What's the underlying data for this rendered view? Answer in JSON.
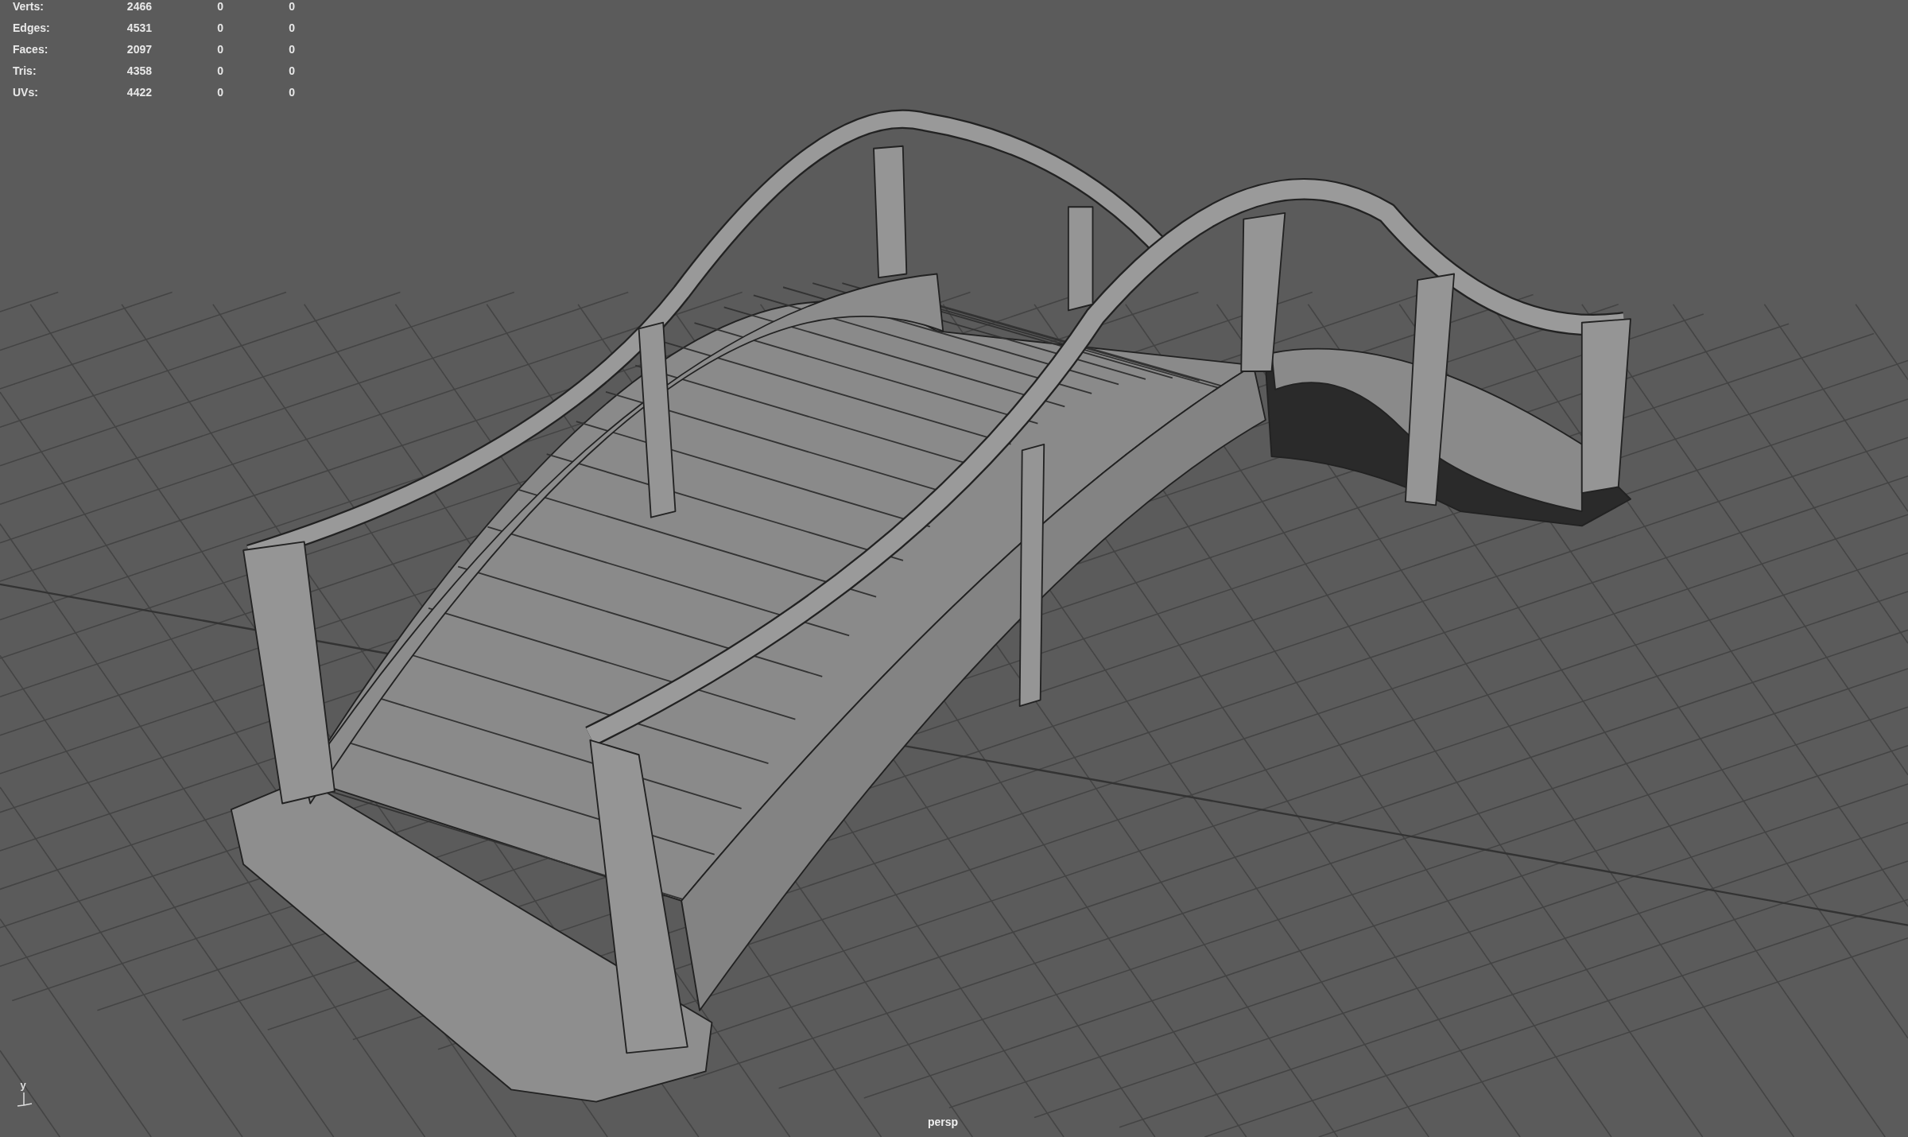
{
  "hud": {
    "stats": [
      {
        "label": "Verts:",
        "values": [
          "2466",
          "0",
          "0"
        ]
      },
      {
        "label": "Edges:",
        "values": [
          "4531",
          "0",
          "0"
        ]
      },
      {
        "label": "Faces:",
        "values": [
          "2097",
          "0",
          "0"
        ]
      },
      {
        "label": "Tris:",
        "values": [
          "4358",
          "0",
          "0"
        ]
      },
      {
        "label": "UVs:",
        "values": [
          "4422",
          "0",
          "0"
        ]
      }
    ]
  },
  "axis_gizmo": {
    "label": "y"
  },
  "camera": "persp"
}
